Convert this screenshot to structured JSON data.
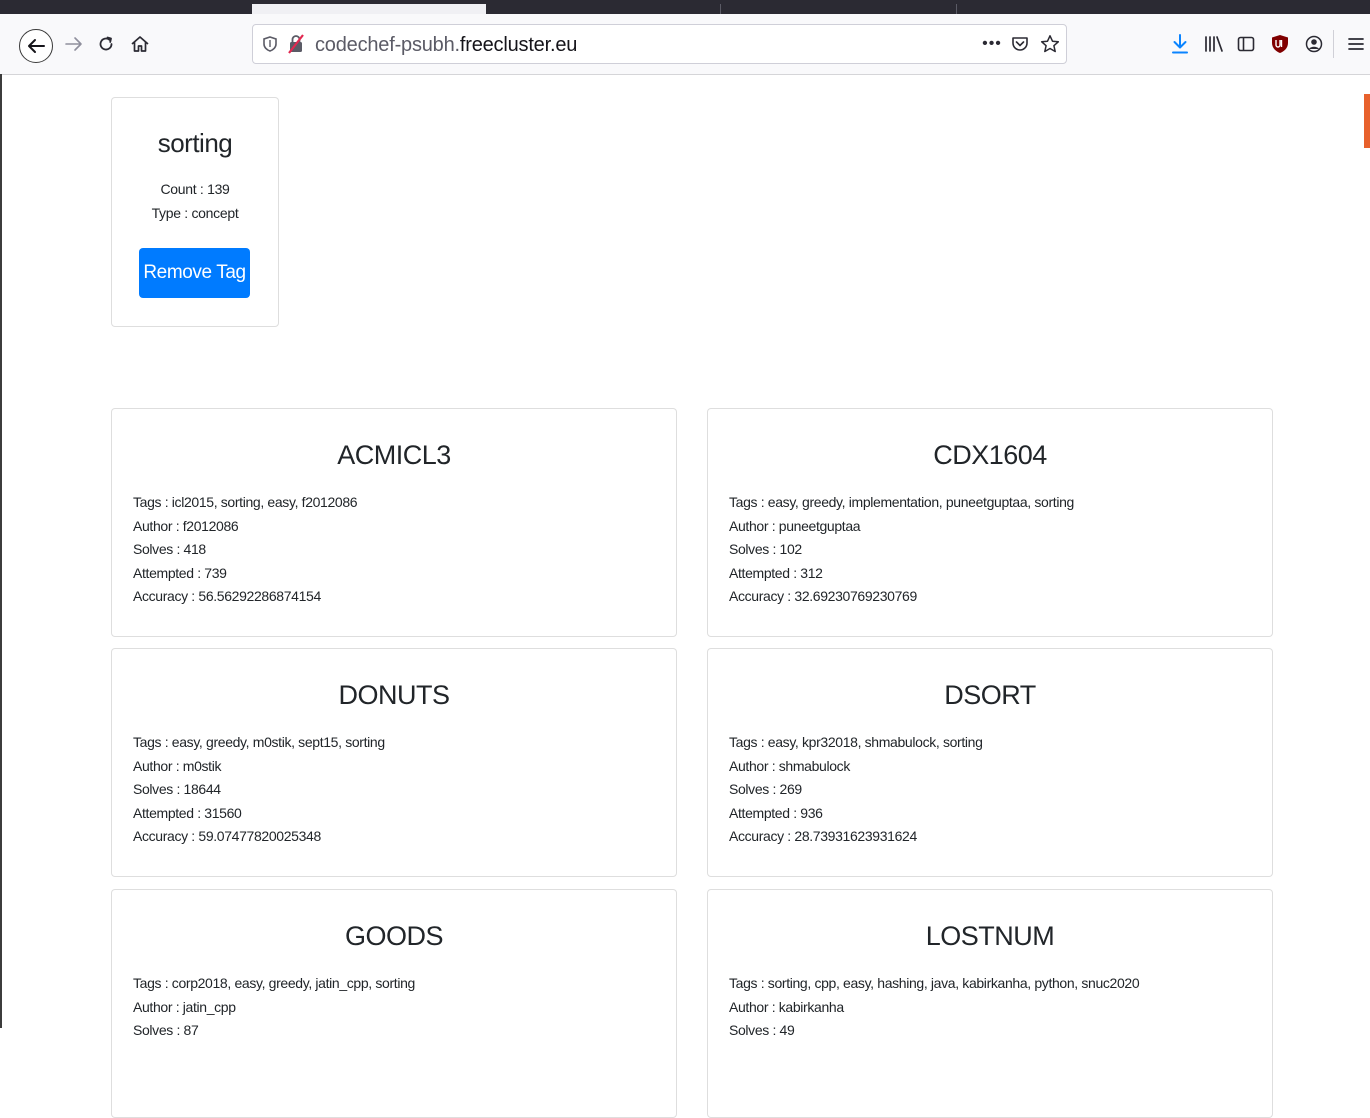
{
  "browser": {
    "url_prefix": "codechef-psubh.",
    "url_host": "freecluster.eu",
    "page_actions_icon": "•••"
  },
  "tag_card": {
    "title": "sorting",
    "count_label": "Count : 139",
    "type_label": "Type : concept",
    "remove_button": "Remove Tag"
  },
  "problems": [
    {
      "code": "ACMICL3",
      "tags": "Tags : icl2015, sorting, easy, f2012086",
      "author": "Author : f2012086",
      "solves": "Solves : 418",
      "attempted": "Attempted : 739",
      "accuracy": "Accuracy : 56.56292286874154"
    },
    {
      "code": "CDX1604",
      "tags": "Tags : easy, greedy, implementation, puneetguptaa, sorting",
      "author": "Author : puneetguptaa",
      "solves": "Solves : 102",
      "attempted": "Attempted : 312",
      "accuracy": "Accuracy : 32.69230769230769"
    },
    {
      "code": "DONUTS",
      "tags": "Tags : easy, greedy, m0stik, sept15, sorting",
      "author": "Author : m0stik",
      "solves": "Solves : 18644",
      "attempted": "Attempted : 31560",
      "accuracy": "Accuracy : 59.07477820025348"
    },
    {
      "code": "DSORT",
      "tags": "Tags : easy, kpr32018, shmabulock, sorting",
      "author": "Author : shmabulock",
      "solves": "Solves : 269",
      "attempted": "Attempted : 936",
      "accuracy": "Accuracy : 28.73931623931624"
    },
    {
      "code": "GOODS",
      "tags": "Tags : corp2018, easy, greedy, jatin_cpp, sorting",
      "author": "Author : jatin_cpp",
      "solves": "Solves : 87"
    },
    {
      "code": "LOSTNUM",
      "tags": "Tags : sorting, cpp, easy, hashing, java, kabirkanha, python, snuc2020",
      "author": "Author : kabirkanha",
      "solves": "Solves : 49"
    }
  ]
}
